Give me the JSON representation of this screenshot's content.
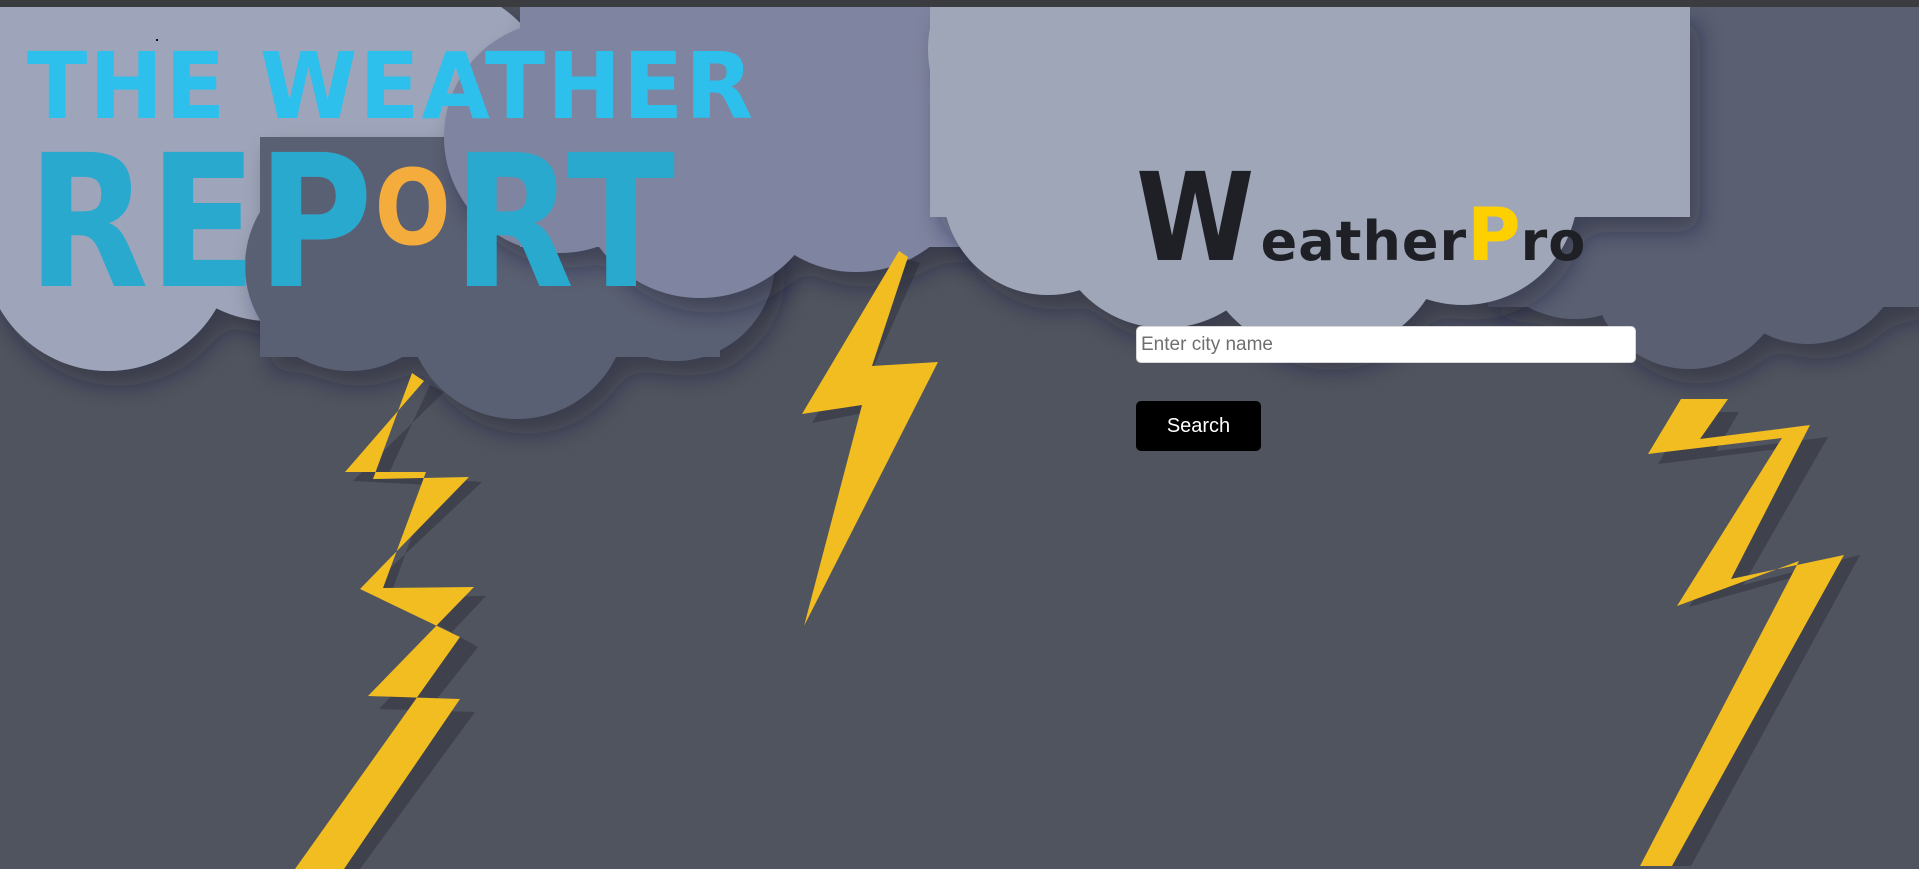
{
  "colors": {
    "logo_cyan": "#2ec0ec",
    "logo_orange": "#f4ad3d",
    "brand_dark": "#1f2025",
    "brand_yellow": "#ffd000",
    "button_black": "#000000",
    "background_gray": "#50545f"
  },
  "icons": {
    "clouds": "storm-cloud-icon",
    "lightning": "lightning-bolt-icon"
  },
  "logo": {
    "line_1": "THE WEATHER",
    "line_2_part_1": "REP",
    "line_2_circle": "O",
    "line_2_part_2": "RT"
  },
  "brand": {
    "first_letter": "W",
    "middle": "eather",
    "second_letter": "P",
    "end": "ro"
  },
  "search": {
    "placeholder": "Enter city name",
    "button_label": "Search"
  }
}
